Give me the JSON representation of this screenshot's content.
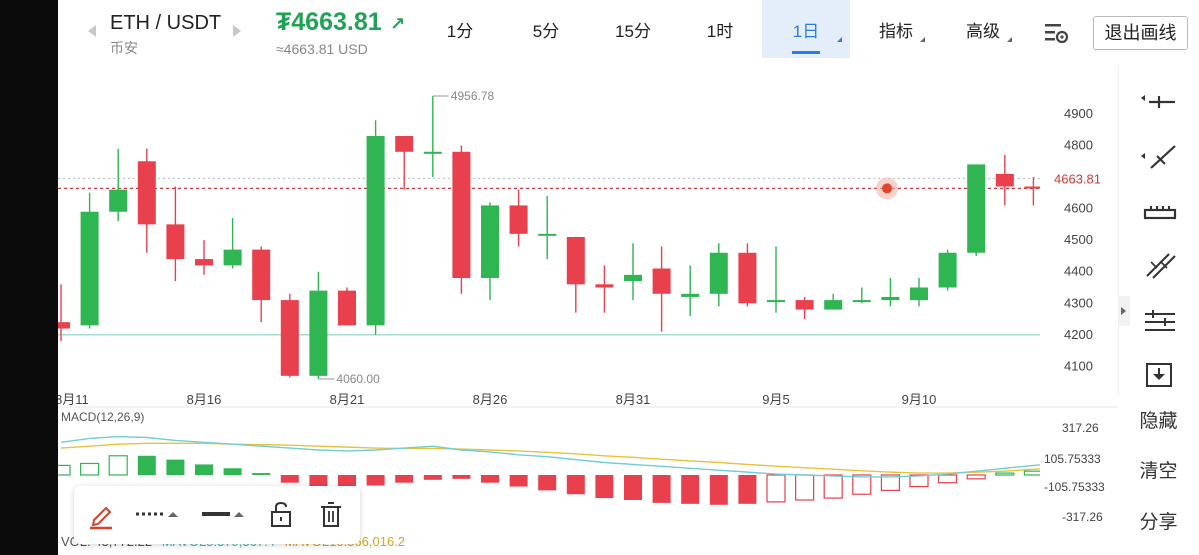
{
  "header": {
    "pair": "ETH / USDT",
    "exchange": "币安",
    "price": "₮4663.81",
    "price_arrow": "↗",
    "price_usd": "≈4663.81 USD",
    "timeframes": [
      "1分",
      "5分",
      "15分",
      "1时",
      "1日"
    ],
    "active_timeframe": "1日",
    "indicator_label": "指标",
    "advanced_label": "高级",
    "exit_label": "退出画线"
  },
  "sidebar": {
    "actions": [
      "隐藏",
      "清空",
      "分享"
    ]
  },
  "drawing_toolbar": {
    "tools": [
      "pencil-icon",
      "line-style-icon",
      "line-width-icon",
      "lock-icon",
      "trash-icon"
    ]
  },
  "colors": {
    "up": "#2fb552",
    "down": "#e8404d",
    "accent": "#2d7be5",
    "price_line": "#c93a3a",
    "macd_yellow": "#e8c33a",
    "macd_cyan": "#6fcfd3",
    "support_line": "#8ad3c3"
  },
  "chart_data": {
    "type": "candlestick",
    "y_ticks": [
      "4900",
      "4800",
      "4700",
      "4600",
      "4500",
      "4400",
      "4300",
      "4200",
      "4100"
    ],
    "ylim": [
      4060,
      4956.78
    ],
    "current_price_label": "4663.81",
    "high_label": "4956.78",
    "low_label": "4060.00",
    "support_level": 4200,
    "x_labels": [
      "8月11",
      "8月16",
      "8月21",
      "8月26",
      "8月31",
      "9月5",
      "9月10"
    ],
    "candles": [
      {
        "o": 4240,
        "h": 4360,
        "l": 4180,
        "c": 4220
      },
      {
        "o": 4230,
        "h": 4650,
        "l": 4220,
        "c": 4590
      },
      {
        "o": 4590,
        "h": 4790,
        "l": 4560,
        "c": 4660
      },
      {
        "o": 4750,
        "h": 4790,
        "l": 4460,
        "c": 4550
      },
      {
        "o": 4550,
        "h": 4670,
        "l": 4370,
        "c": 4440
      },
      {
        "o": 4440,
        "h": 4500,
        "l": 4390,
        "c": 4420
      },
      {
        "o": 4420,
        "h": 4570,
        "l": 4410,
        "c": 4470
      },
      {
        "o": 4470,
        "h": 4480,
        "l": 4240,
        "c": 4310
      },
      {
        "o": 4310,
        "h": 4330,
        "l": 4065,
        "c": 4070
      },
      {
        "o": 4070,
        "h": 4400,
        "l": 4060,
        "c": 4340
      },
      {
        "o": 4340,
        "h": 4350,
        "l": 4230,
        "c": 4230
      },
      {
        "o": 4230,
        "h": 4880,
        "l": 4200,
        "c": 4830
      },
      {
        "o": 4830,
        "h": 4830,
        "l": 4660,
        "c": 4780
      },
      {
        "o": 4780,
        "h": 4956.78,
        "l": 4700,
        "c": 4780
      },
      {
        "o": 4780,
        "h": 4800,
        "l": 4330,
        "c": 4380
      },
      {
        "o": 4380,
        "h": 4620,
        "l": 4310,
        "c": 4610
      },
      {
        "o": 4610,
        "h": 4660,
        "l": 4480,
        "c": 4520
      },
      {
        "o": 4520,
        "h": 4640,
        "l": 4440,
        "c": 4520
      },
      {
        "o": 4510,
        "h": 4510,
        "l": 4270,
        "c": 4360
      },
      {
        "o": 4360,
        "h": 4420,
        "l": 4270,
        "c": 4350
      },
      {
        "o": 4370,
        "h": 4490,
        "l": 4310,
        "c": 4390
      },
      {
        "o": 4410,
        "h": 4480,
        "l": 4210,
        "c": 4330
      },
      {
        "o": 4320,
        "h": 4420,
        "l": 4260,
        "c": 4330
      },
      {
        "o": 4330,
        "h": 4490,
        "l": 4290,
        "c": 4460
      },
      {
        "o": 4460,
        "h": 4490,
        "l": 4290,
        "c": 4300
      },
      {
        "o": 4310,
        "h": 4480,
        "l": 4270,
        "c": 4310
      },
      {
        "o": 4310,
        "h": 4320,
        "l": 4250,
        "c": 4280
      },
      {
        "o": 4280,
        "h": 4330,
        "l": 4280,
        "c": 4310
      },
      {
        "o": 4310,
        "h": 4350,
        "l": 4300,
        "c": 4310
      },
      {
        "o": 4310,
        "h": 4380,
        "l": 4290,
        "c": 4320
      },
      {
        "o": 4310,
        "h": 4380,
        "l": 4290,
        "c": 4350
      },
      {
        "o": 4350,
        "h": 4470,
        "l": 4340,
        "c": 4460
      },
      {
        "o": 4460,
        "h": 4480,
        "l": 4450,
        "c": 4740
      },
      {
        "o": 4710,
        "h": 4770,
        "l": 4610,
        "c": 4670
      },
      {
        "o": 4670,
        "h": 4700,
        "l": 4610,
        "c": 4664
      }
    ],
    "macd": {
      "title": "MACD(12,26,9)",
      "ticks": [
        "317.26",
        "105.75333",
        "-105.75333",
        "-317.26"
      ],
      "ylim": [
        -317.26,
        317.26
      ],
      "hist": [
        50,
        60,
        100,
        100,
        80,
        55,
        35,
        10,
        -40,
        -60,
        -75,
        -55,
        -40,
        -25,
        -20,
        -40,
        -60,
        -80,
        -100,
        -120,
        -130,
        -145,
        -150,
        -155,
        -150,
        -140,
        -130,
        -120,
        -100,
        -80,
        -60,
        -40,
        -20,
        10,
        20,
        30
      ],
      "dif": [
        170,
        190,
        200,
        195,
        180,
        170,
        160,
        150,
        140,
        130,
        125,
        130,
        140,
        150,
        130,
        120,
        105,
        95,
        80,
        65,
        55,
        45,
        35,
        25,
        15,
        5,
        0,
        -5,
        -10,
        -10,
        -5,
        5,
        20,
        35,
        50,
        60
      ],
      "dea": [
        140,
        150,
        160,
        165,
        165,
        165,
        160,
        158,
        155,
        150,
        145,
        140,
        138,
        138,
        135,
        130,
        125,
        118,
        110,
        100,
        92,
        82,
        73,
        65,
        55,
        46,
        38,
        30,
        22,
        15,
        10,
        10,
        15,
        20,
        30,
        40
      ]
    },
    "volume": {
      "vol": "VOL: 43,772.22",
      "mavol5": "MAVOL5:379,367.4",
      "mavol10": "MAVOL10:366,016.2"
    }
  }
}
